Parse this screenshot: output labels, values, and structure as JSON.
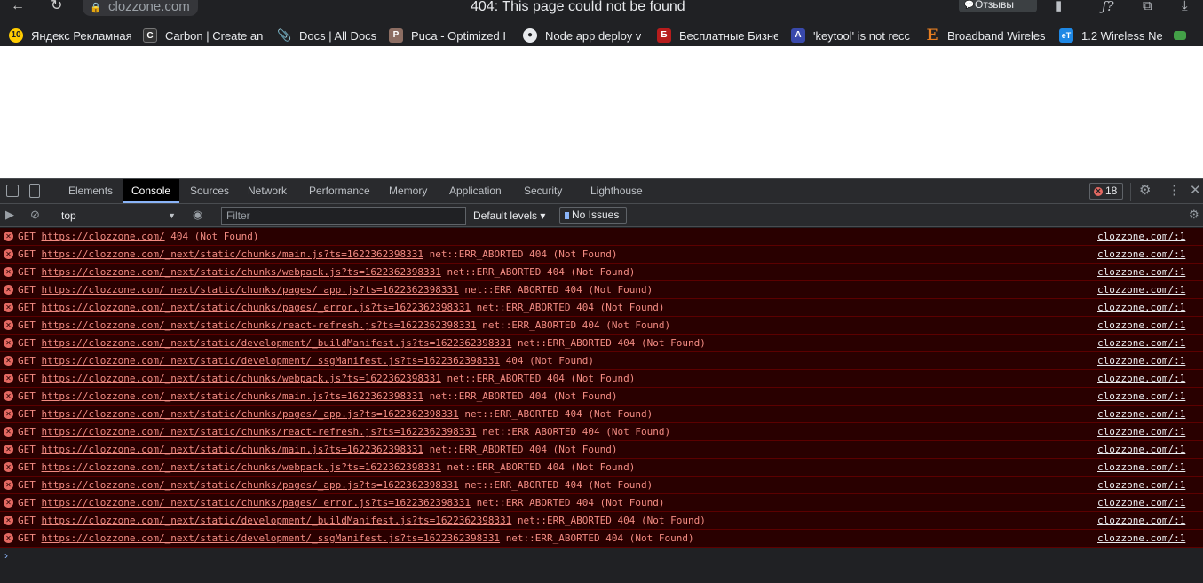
{
  "browser": {
    "address": "clozzone.com",
    "title": "404: This page could not be found",
    "feedback_label": "Отзывы"
  },
  "bookmarks": [
    {
      "label": "Яндекс Рекламная",
      "icon": "yandex-icon",
      "color": "#ffcc00"
    },
    {
      "label": "Carbon | Create an",
      "icon": "carbon-icon",
      "color": "#333333"
    },
    {
      "label": "Docs | All Docs",
      "icon": "paperclip-icon",
      "color": "#5f6368"
    },
    {
      "label": "Puca - Optimized I",
      "icon": "puca-icon",
      "color": "#8d6e63"
    },
    {
      "label": "Node app deploy v",
      "icon": "github-icon",
      "color": "#202124"
    },
    {
      "label": "Бесплатные Бизне",
      "icon": "business-icon",
      "color": "#b71c1c"
    },
    {
      "label": "'keytool' is not recc",
      "icon": "a-icon",
      "color": "#3949ab"
    },
    {
      "label": "Broadband Wireles",
      "icon": "e-icon",
      "color": "#e67e22"
    },
    {
      "label": "1.2 Wireless Ne",
      "icon": "et-icon",
      "color": "#1e88e5"
    }
  ],
  "devtools": {
    "tabs": [
      "Elements",
      "Console",
      "Sources",
      "Network",
      "Performance",
      "Memory",
      "Application",
      "Security",
      "Lighthouse"
    ],
    "active_tab": "Console",
    "error_count": "18",
    "context": "top",
    "filter_placeholder": "Filter",
    "default_levels": "Default levels ▾",
    "no_issues": "No Issues"
  },
  "console": {
    "entries": [
      {
        "method": "GET",
        "url": "https://clozzone.com/",
        "detail": "404 (Not Found)",
        "source": "clozzone.com/:1"
      },
      {
        "method": "GET",
        "url": "https://clozzone.com/_next/static/chunks/main.js?ts=1622362398331",
        "detail": "net::ERR_ABORTED 404 (Not Found)",
        "source": "clozzone.com/:1"
      },
      {
        "method": "GET",
        "url": "https://clozzone.com/_next/static/chunks/webpack.js?ts=1622362398331",
        "detail": "net::ERR_ABORTED 404 (Not Found)",
        "source": "clozzone.com/:1"
      },
      {
        "method": "GET",
        "url": "https://clozzone.com/_next/static/chunks/pages/_app.js?ts=1622362398331",
        "detail": "net::ERR_ABORTED 404 (Not Found)",
        "source": "clozzone.com/:1"
      },
      {
        "method": "GET",
        "url": "https://clozzone.com/_next/static/chunks/pages/_error.js?ts=1622362398331",
        "detail": "net::ERR_ABORTED 404 (Not Found)",
        "source": "clozzone.com/:1"
      },
      {
        "method": "GET",
        "url": "https://clozzone.com/_next/static/chunks/react-refresh.js?ts=1622362398331",
        "detail": "net::ERR_ABORTED 404 (Not Found)",
        "source": "clozzone.com/:1"
      },
      {
        "method": "GET",
        "url": "https://clozzone.com/_next/static/development/_buildManifest.js?ts=1622362398331",
        "detail": "net::ERR_ABORTED 404 (Not Found)",
        "source": "clozzone.com/:1"
      },
      {
        "method": "GET",
        "url": "https://clozzone.com/_next/static/development/_ssgManifest.js?ts=1622362398331",
        "detail": "404 (Not Found)",
        "source": "clozzone.com/:1"
      },
      {
        "method": "GET",
        "url": "https://clozzone.com/_next/static/chunks/webpack.js?ts=1622362398331",
        "detail": "net::ERR_ABORTED 404 (Not Found)",
        "source": "clozzone.com/:1"
      },
      {
        "method": "GET",
        "url": "https://clozzone.com/_next/static/chunks/main.js?ts=1622362398331",
        "detail": "net::ERR_ABORTED 404 (Not Found)",
        "source": "clozzone.com/:1"
      },
      {
        "method": "GET",
        "url": "https://clozzone.com/_next/static/chunks/pages/_app.js?ts=1622362398331",
        "detail": "net::ERR_ABORTED 404 (Not Found)",
        "source": "clozzone.com/:1"
      },
      {
        "method": "GET",
        "url": "https://clozzone.com/_next/static/chunks/react-refresh.js?ts=1622362398331",
        "detail": "net::ERR_ABORTED 404 (Not Found)",
        "source": "clozzone.com/:1"
      },
      {
        "method": "GET",
        "url": "https://clozzone.com/_next/static/chunks/main.js?ts=1622362398331",
        "detail": "net::ERR_ABORTED 404 (Not Found)",
        "source": "clozzone.com/:1"
      },
      {
        "method": "GET",
        "url": "https://clozzone.com/_next/static/chunks/webpack.js?ts=1622362398331",
        "detail": "net::ERR_ABORTED 404 (Not Found)",
        "source": "clozzone.com/:1"
      },
      {
        "method": "GET",
        "url": "https://clozzone.com/_next/static/chunks/pages/_app.js?ts=1622362398331",
        "detail": "net::ERR_ABORTED 404 (Not Found)",
        "source": "clozzone.com/:1"
      },
      {
        "method": "GET",
        "url": "https://clozzone.com/_next/static/chunks/pages/_error.js?ts=1622362398331",
        "detail": "net::ERR_ABORTED 404 (Not Found)",
        "source": "clozzone.com/:1"
      },
      {
        "method": "GET",
        "url": "https://clozzone.com/_next/static/development/_buildManifest.js?ts=1622362398331",
        "detail": "net::ERR_ABORTED 404 (Not Found)",
        "source": "clozzone.com/:1"
      },
      {
        "method": "GET",
        "url": "https://clozzone.com/_next/static/development/_ssgManifest.js?ts=1622362398331",
        "detail": "net::ERR_ABORTED 404 (Not Found)",
        "source": "clozzone.com/:1"
      }
    ]
  },
  "colors": {
    "error_text": "#f28b82",
    "error_bg": "#290000",
    "accent": "#8ab4f8"
  }
}
